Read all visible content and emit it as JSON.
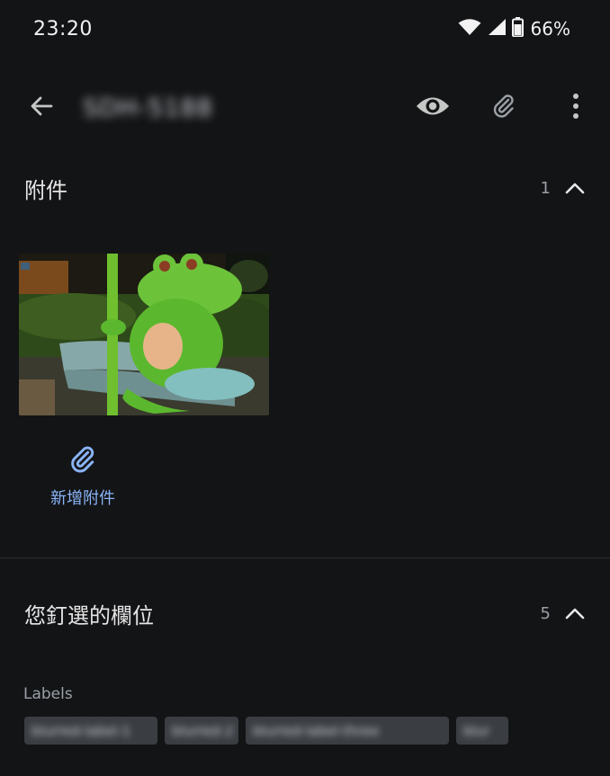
{
  "status_bar": {
    "time": "23:20",
    "battery": "66%",
    "icons": [
      "wifi-icon",
      "cell-signal-icon",
      "battery-icon"
    ]
  },
  "toolbar": {
    "issue_key": "SDH-5188",
    "actions": [
      "back-arrow-icon",
      "eye-icon",
      "paperclip-icon",
      "more-vert-icon"
    ]
  },
  "attachments": {
    "title": "附件",
    "count": "1",
    "add_label": "新增附件",
    "thumbnail": "frog-statue-photo"
  },
  "pinned_fields": {
    "title": "您釘選的欄位",
    "count": "5",
    "labels_heading": "Labels",
    "labels": [
      "blurred-label-1",
      "blurred-2",
      "blurred-label-three",
      "blur"
    ]
  },
  "colors": {
    "background": "#131416",
    "accent": "#8ab4f8",
    "chip_bg": "#3a3d41",
    "icon": "#c4c7c5"
  }
}
